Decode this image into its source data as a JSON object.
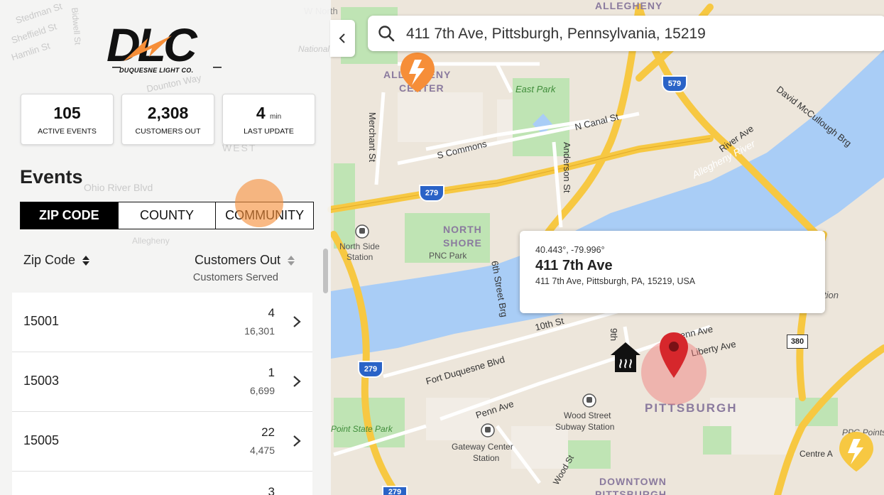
{
  "brand": {
    "logo_text": "DLC",
    "tagline": "DUQUESNE LIGHT CO.",
    "accent_color": "#f68e38",
    "primary_color": "#111111"
  },
  "stats": [
    {
      "value": "105",
      "unit": "",
      "label": "ACTIVE EVENTS"
    },
    {
      "value": "2,308",
      "unit": "",
      "label": "CUSTOMERS OUT"
    },
    {
      "value": "4",
      "unit": "min",
      "label": "LAST UPDATE"
    }
  ],
  "events": {
    "title": "Events",
    "tabs": [
      "ZIP CODE",
      "COUNTY",
      "COMMUNITY"
    ],
    "active_tab": "ZIP CODE",
    "columns": {
      "zip_header": "Zip Code",
      "customers_header": "Customers Out",
      "customers_sub": "Customers Served"
    },
    "rows": [
      {
        "zip": "15001",
        "out": "4",
        "served": "16,301"
      },
      {
        "zip": "15003",
        "out": "1",
        "served": "6,699"
      },
      {
        "zip": "15005",
        "out": "22",
        "served": "4,475"
      },
      {
        "zip": "",
        "out": "3",
        "served": ""
      }
    ]
  },
  "search": {
    "value": "411 7th Ave, Pittsburgh, Pennsylvania, 15219"
  },
  "popup": {
    "coords": "40.443°, -79.996°",
    "title": "411 7th Ave",
    "address": "411 7th Ave, Pittsburgh, PA, 15219, USA"
  },
  "map": {
    "labels": {
      "pittsburgh": "PITTSBURGH",
      "north": "NORTH",
      "shore": "SHORE",
      "pnc_park": "PNC Park",
      "north_side_station": "North Side",
      "north_side_station2": "Station",
      "east_park": "East Park",
      "allegheny_river": "Allegheny River",
      "allegheny_center": "ALLEGHENY",
      "allegheny_center2": "CENTER",
      "merchant_st": "Merchant St",
      "anderson_st": "Anderson St",
      "s_commons": "S Commons",
      "n_canal_st": "N Canal St",
      "river_ave": "River Ave",
      "david_mccullough": "David McCullough Brg",
      "sixth_street_brg": "6th Street Brg",
      "tenth_st": "10th St",
      "fort_duquesne_blvd": "Fort Duquesne Blvd",
      "penn_ave": "Penn Ave",
      "penn_ave2": "Penn Ave",
      "liberty_ave": "Liberty Ave",
      "ninth": "9th",
      "wood_street_station": "Wood Street",
      "wood_street_station2": "Subway Station",
      "gateway_center": "Gateway Center",
      "gateway_center2": "Station",
      "point_state_park": "Point State Park",
      "wood_st": "Wood St",
      "downtown": "DOWNTOWN",
      "downtown2": "PITTSBURGH",
      "ppg_points": "PPG Points",
      "centre_ave": "Centre A",
      "stedman_st": "Stedman St",
      "sheffield_st": "Sheffield St",
      "hamlin_st": "Hamlin St",
      "bidwell_st": "Bidwell St",
      "dounton_way": "Dounton Way",
      "ohio_river_blvd": "Ohio River Blvd",
      "west": "WEST",
      "allegheny_west": "Allegheny",
      "national_aviary": "National Aviary",
      "w_north": "W North",
      "allegheny_top": "ALLEGHENY",
      "shield_279a": "279",
      "shield_279b": "279",
      "shield_579": "579",
      "shield_380": "380",
      "shield_279c": "279",
      "station_tion": "tion"
    },
    "colors": {
      "water": "#a9cdf6",
      "park": "#bfe4b4",
      "highway": "#f7c842",
      "land": "#ede6db",
      "marker": "#d6272c",
      "outage": "#f68e38"
    }
  }
}
